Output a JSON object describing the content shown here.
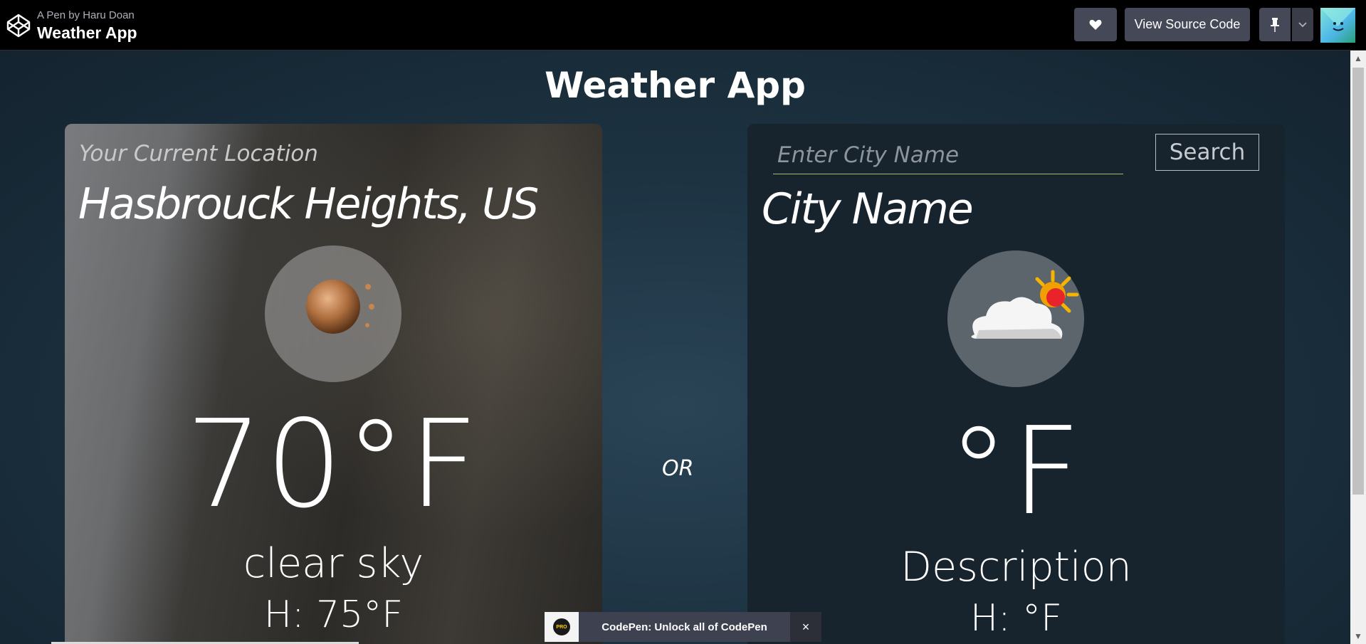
{
  "codepen": {
    "pen_by": "A Pen by Haru Doan",
    "pen_title": "Weather App",
    "view_source_label": "View Source Code",
    "promo_text": "CodePen: Unlock all of CodePen",
    "promo_badge": "PRO",
    "promo_close": "×"
  },
  "app": {
    "title": "Weather App",
    "or_label": "OR"
  },
  "current": {
    "caption": "Your Current Location",
    "city": "Hasbrouck Heights, US",
    "temp": "70°F",
    "description": "clear sky",
    "high": "H: 75°F",
    "icon": "clear-sky-icon"
  },
  "search": {
    "placeholder": "Enter City Name",
    "button_label": "Search",
    "city": "City Name",
    "temp": "°F",
    "description": "Description",
    "high": "H: °F",
    "icon": "partly-cloudy-icon"
  },
  "colors": {
    "accent_underline": "#9bc26a",
    "button_bg": "#444857"
  }
}
